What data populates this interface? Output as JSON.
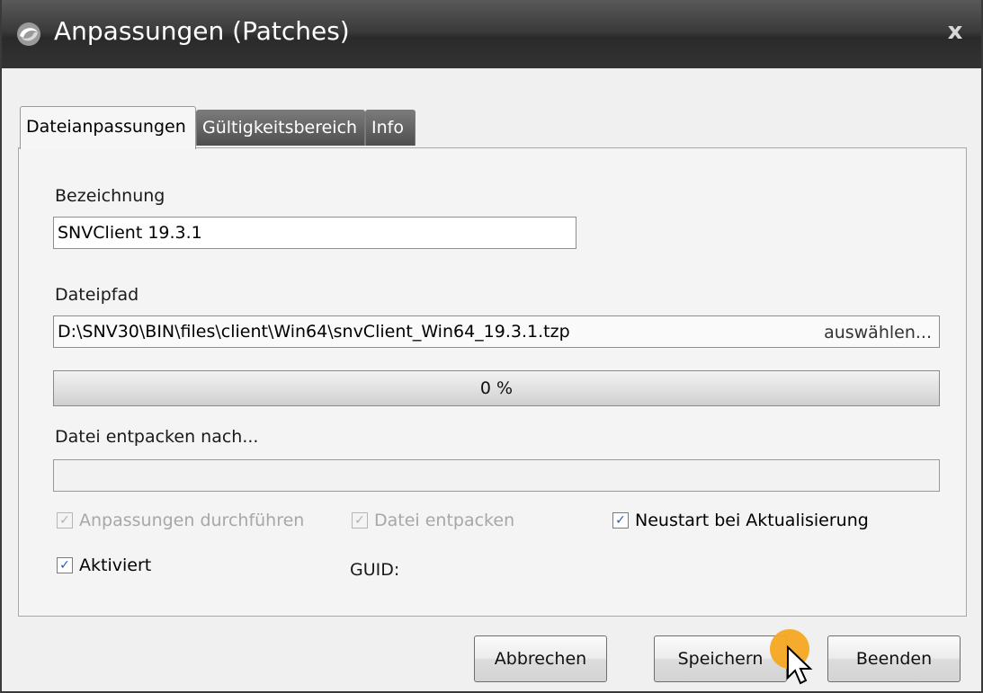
{
  "window": {
    "title": "Anpassungen (Patches)",
    "close_label": "x",
    "app_icon": "swirl-app-icon"
  },
  "tabs": [
    {
      "label": "Dateianpassungen",
      "active": true
    },
    {
      "label": "Gültigkeitsbereich",
      "active": false
    },
    {
      "label": "Info",
      "active": false
    }
  ],
  "form": {
    "name_label": "Bezeichnung",
    "name_value": "SNVClient 19.3.1",
    "path_label": "Dateipfad",
    "path_value": "D:\\SNV30\\BIN\\files\\client\\Win64\\snvClient_Win64_19.3.1.tzp",
    "browse_label": "auswählen...",
    "progress_text": "0 %",
    "progress_value": 0,
    "extract_label": "Datei entpacken nach...",
    "extract_value": "",
    "cb_apply_label": "Anpassungen durchführen",
    "cb_apply_checked": true,
    "cb_extract_label": "Datei entpacken",
    "cb_extract_checked": true,
    "cb_restart_label": "Neustart bei Aktualisierung",
    "cb_restart_checked": true,
    "cb_active_label": "Aktiviert",
    "cb_active_checked": true,
    "guid_label": "GUID:",
    "check_mark": "✓"
  },
  "buttons": {
    "cancel": "Abbrechen",
    "save": "Speichern",
    "close": "Beenden"
  },
  "colors": {
    "cursor_highlight": "#f4a620",
    "checkbox_check": "#1b5fb8"
  }
}
